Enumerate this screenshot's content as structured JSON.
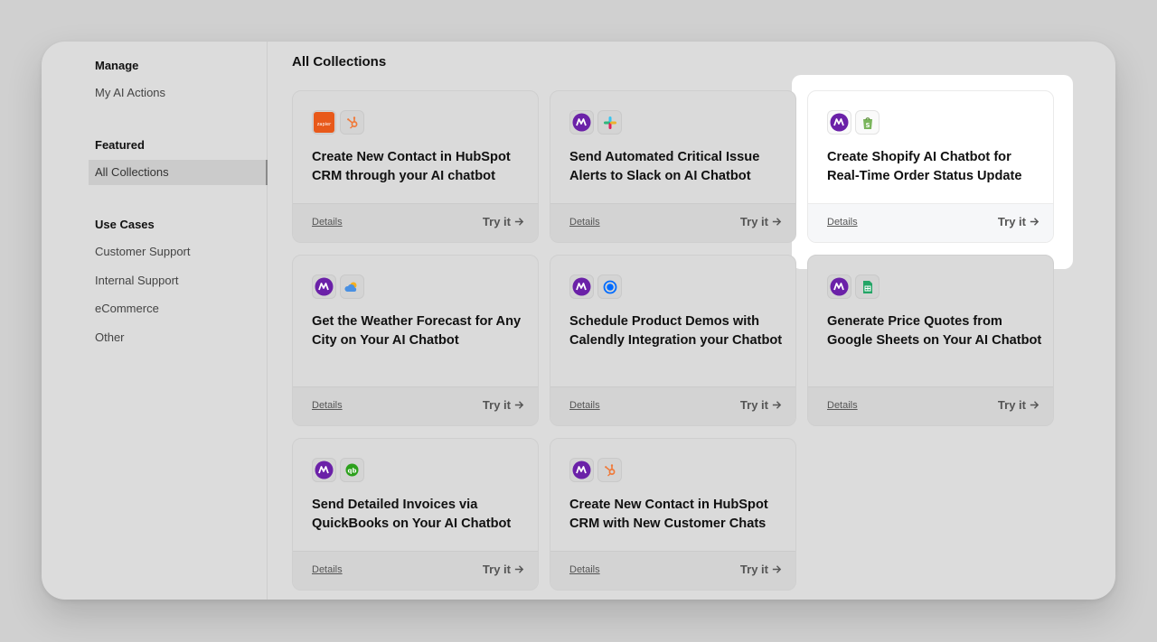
{
  "sidebar": {
    "sections": [
      {
        "heading": "Manage",
        "items": [
          {
            "label": "My AI Actions"
          }
        ]
      },
      {
        "heading": "Featured",
        "items": [
          {
            "label": "All Collections",
            "active": true
          }
        ]
      },
      {
        "heading": "Use Cases",
        "items": [
          {
            "label": "Customer Support"
          },
          {
            "label": "Internal Support"
          },
          {
            "label": "eCommerce"
          },
          {
            "label": "Other"
          }
        ]
      }
    ]
  },
  "main": {
    "title": "All Collections",
    "details_label": "Details",
    "try_label": "Try it",
    "cards": [
      {
        "title": "Create New Contact in HubSpot CRM through your AI chatbot",
        "icons": [
          "zapier-icon",
          "hubspot-icon"
        ]
      },
      {
        "title": "Send Automated Critical Issue Alerts to Slack on AI Chatbot",
        "icons": [
          "chatbot-logo-icon",
          "slack-icon"
        ]
      },
      {
        "title": "Create Shopify AI Chatbot for Real-Time Order Status Update",
        "icons": [
          "chatbot-logo-icon",
          "shopify-icon"
        ],
        "highlighted": true
      },
      {
        "title": "Get the Weather Forecast for Any City on Your AI Chatbot",
        "icons": [
          "chatbot-logo-icon",
          "weather-icon"
        ]
      },
      {
        "title": "Schedule Product Demos with Calendly Integration your Chatbot",
        "icons": [
          "chatbot-logo-icon",
          "calendly-icon"
        ]
      },
      {
        "title": "Generate Price Quotes from Google Sheets on Your AI Chatbot",
        "icons": [
          "chatbot-logo-icon",
          "google-sheets-icon"
        ]
      },
      {
        "title": "Send Detailed Invoices via QuickBooks on Your AI Chatbot",
        "icons": [
          "chatbot-logo-icon",
          "quickbooks-icon"
        ]
      },
      {
        "title": "Create New Contact in HubSpot CRM with New Customer Chats",
        "icons": [
          "chatbot-logo-icon",
          "hubspot-icon"
        ]
      }
    ]
  },
  "colors": {
    "chatbot_brand": "#6b21a8",
    "zapier": "#e8591a",
    "hubspot": "#f07a3a",
    "shopify": "#7ab55c",
    "sheets": "#23a566",
    "quickbooks": "#2ca01c",
    "calendly": "#006bff",
    "highlight_bg": "#ffffff"
  }
}
